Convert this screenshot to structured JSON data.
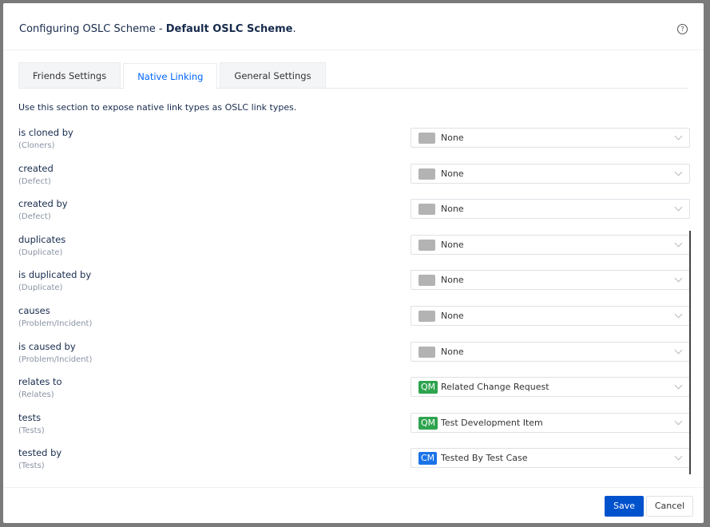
{
  "dialog": {
    "title_prefix": "Configuring OSLC Scheme - ",
    "title_bold": "Default OSLC Scheme",
    "title_suffix": ".",
    "help_icon": "?"
  },
  "tabs": [
    {
      "label": "Friends Settings",
      "active": false
    },
    {
      "label": "Native Linking",
      "active": true
    },
    {
      "label": "General Settings",
      "active": false
    }
  ],
  "description": "Use this section to expose native link types as OSLC link types.",
  "rows": [
    {
      "label": "is cloned by",
      "sub": "(Cloners)",
      "badge": "",
      "value": "None"
    },
    {
      "label": "created",
      "sub": "(Defect)",
      "badge": "",
      "value": "None"
    },
    {
      "label": "created by",
      "sub": "(Defect)",
      "badge": "",
      "value": "None"
    },
    {
      "label": "duplicates",
      "sub": "(Duplicate)",
      "badge": "",
      "value": "None"
    },
    {
      "label": "is duplicated by",
      "sub": "(Duplicate)",
      "badge": "",
      "value": "None"
    },
    {
      "label": "causes",
      "sub": "(Problem/Incident)",
      "badge": "",
      "value": "None"
    },
    {
      "label": "is caused by",
      "sub": "(Problem/Incident)",
      "badge": "",
      "value": "None"
    },
    {
      "label": "relates to",
      "sub": "(Relates)",
      "badge": "QM",
      "value": "Related Change Request"
    },
    {
      "label": "tests",
      "sub": "(Tests)",
      "badge": "QM",
      "value": "Test Development Item"
    },
    {
      "label": "tested by",
      "sub": "(Tests)",
      "badge": "CM",
      "value": "Tested By Test Case"
    }
  ],
  "footer": {
    "save_label": "Save",
    "cancel_label": "Cancel"
  }
}
